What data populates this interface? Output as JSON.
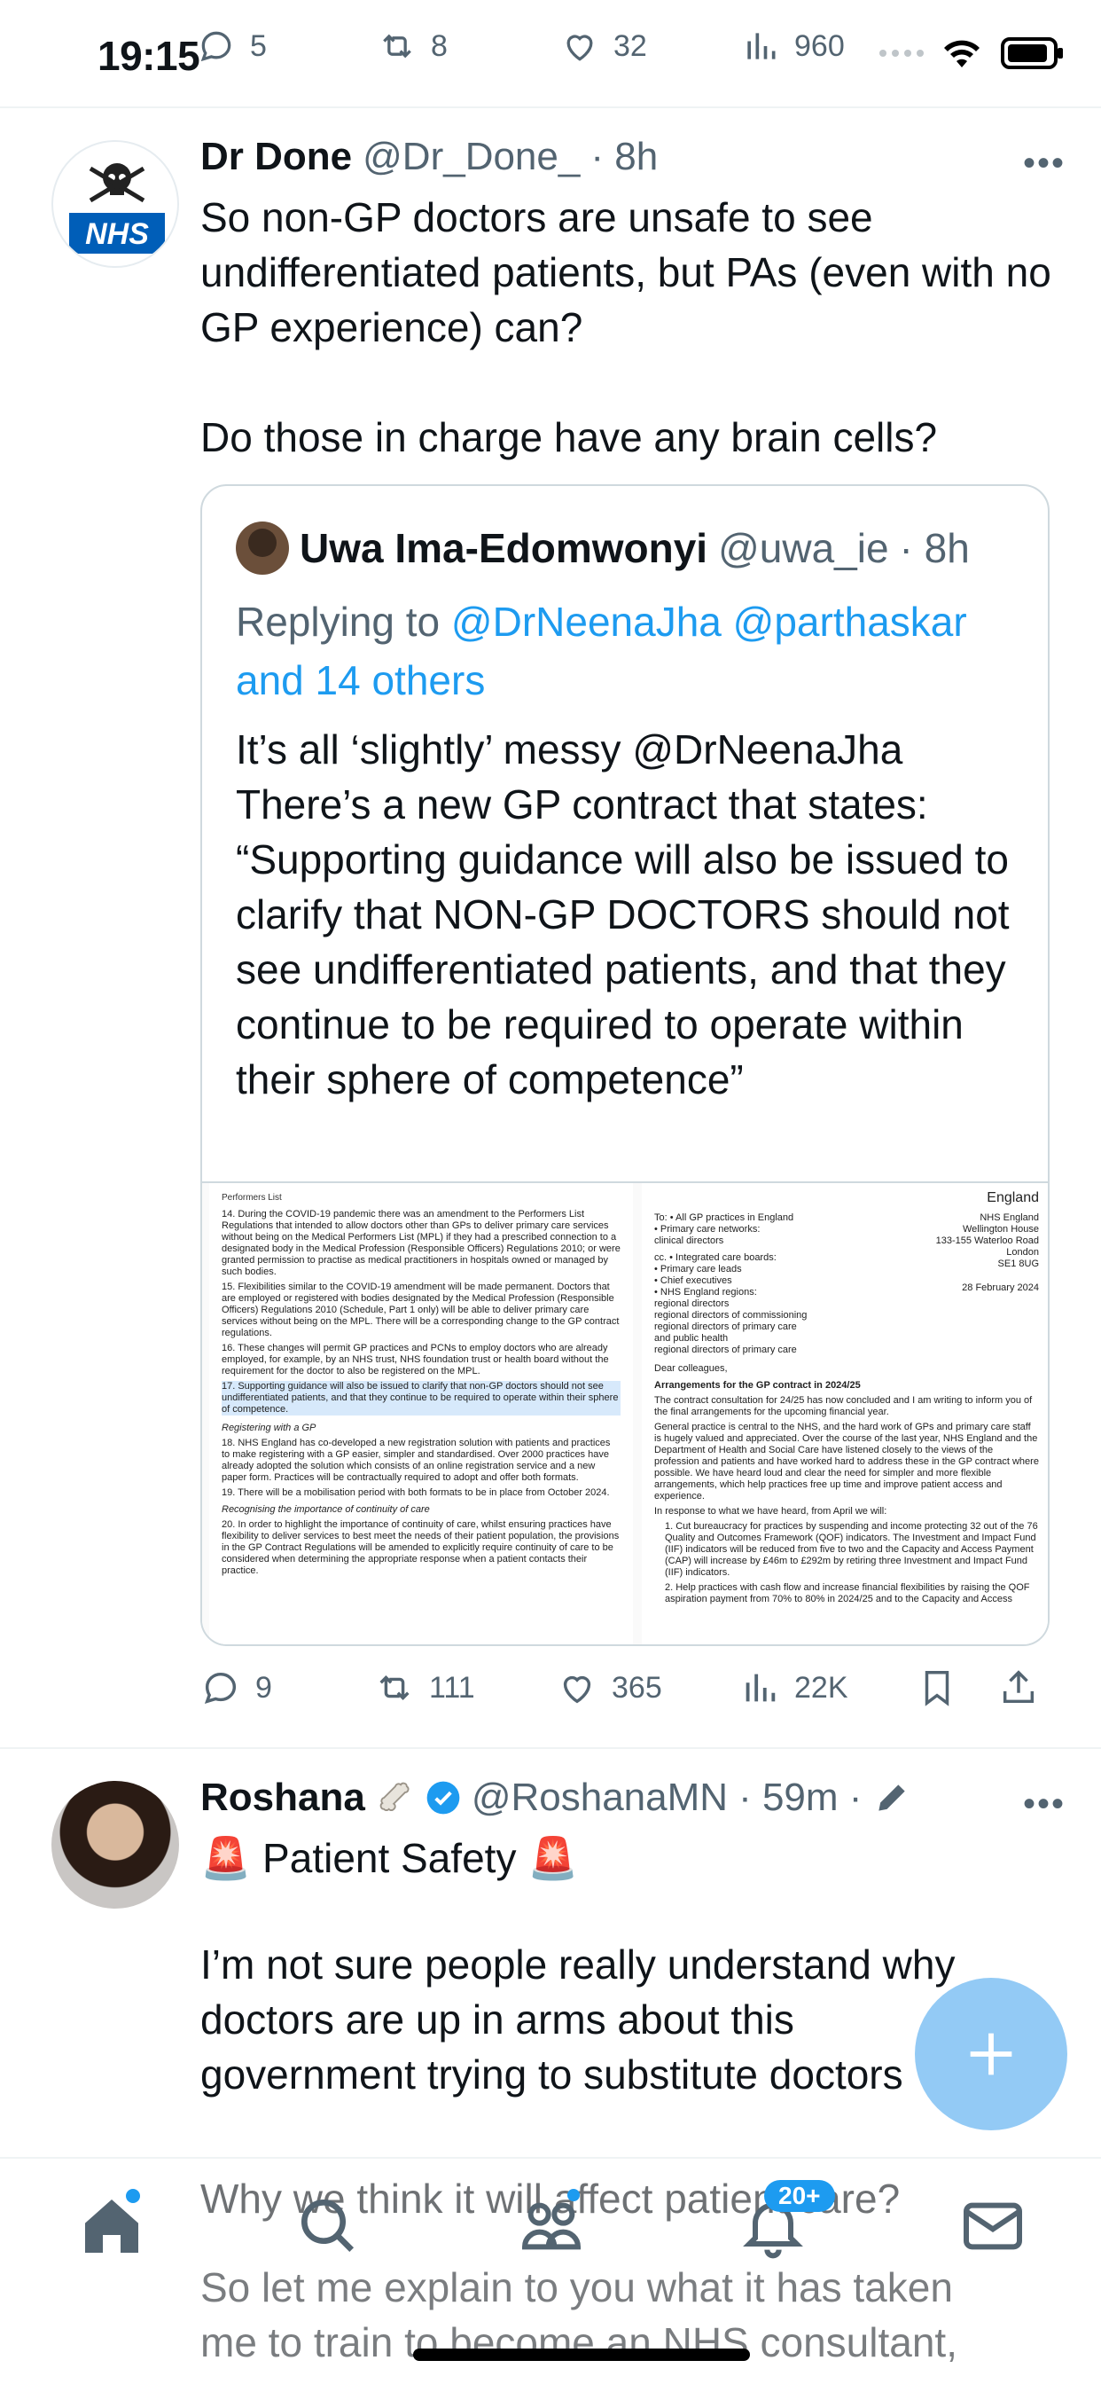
{
  "status": {
    "time": "19:15"
  },
  "prev_tweet_actions": {
    "replies": "5",
    "reposts": "8",
    "likes": "32",
    "views": "960"
  },
  "tweet1": {
    "name": "Dr Done",
    "handle": "@Dr_Done_",
    "time": "· 8h",
    "text_p1": "So non-GP doctors are unsafe to see undifferentiated patients, but PAs (even with no GP experience) can?",
    "text_p2": "Do those in charge have any brain cells?",
    "quote": {
      "name": "Uwa Ima-Edomwonyi",
      "handle": "@uwa_ie",
      "time": "· 8h",
      "replying_prefix": "Replying to",
      "reply_mentions": "@DrNeenaJha @parthaskar and 14 others",
      "text": "It’s all ‘slightly’ messy @DrNeenaJha There’s a new GP contract that states: “Supporting guidance will also be issued to clarify that NON-GP DOCTORS should not see undifferentiated patients, and that they continue to be required to operate within their sphere of competence”",
      "image": {
        "left_header": "Performers List",
        "right_header": "England",
        "p14": "14. During the COVID-19 pandemic there was an amendment to the Performers List Regulations that intended to allow doctors other than GPs to deliver primary care services without being on the Medical Performers List (MPL) if they had a prescribed connection to a designated body in the Medical Profession (Responsible Officers) Regulations 2010; or were granted permission to practise as medical practitioners in hospitals owned or managed by such bodies.",
        "p15": "15. Flexibilities similar to the COVID-19 amendment will be made permanent. Doctors that are employed or registered with bodies designated by the Medical Profession (Responsible Officers) Regulations 2010 (Schedule, Part 1 only) will be able to deliver primary care services without being on the MPL. There will be a corresponding change to the GP contract regulations.",
        "p16": "16. These changes will permit GP practices and PCNs to employ doctors who are already employed, for example, by an NHS trust, NHS foundation trust or health board without the requirement for the doctor to also be registered on the MPL.",
        "p17": "17. Supporting guidance will also be issued to clarify that non-GP doctors should not see undifferentiated patients, and that they continue to be required to operate within their sphere of competence.",
        "sub1": "Registering with a GP",
        "p18": "18. NHS England has co-developed a new registration solution with patients and practices to make registering with a GP easier, simpler and standardised. Over 2000 practices have already adopted the solution which consists of an online registration service and a new paper form. Practices will be contractually required to adopt and offer both formats.",
        "p19": "19. There will be a mobilisation period with both formats to be in place from October 2024.",
        "sub2": "Recognising the importance of continuity of care",
        "p20": "20. In order to highlight the importance of continuity of care, whilst ensuring practices have flexibility to deliver services to best meet the needs of their patient population, the provisions in the GP Contract Regulations will be amended to explicitly require continuity of care to be considered when determining the appropriate response when a patient contacts their practice.",
        "to_label": "To:",
        "to_1": "• All GP practices in England",
        "to_2": "• Primary care networks:",
        "to_2b": "clinical directors",
        "cc_label": "cc.",
        "cc_1": "• Integrated care boards:",
        "cc_2": "• Primary care leads",
        "cc_3": "• Chief executives",
        "cc_4": "• NHS England regions:",
        "cc_4b": "regional directors",
        "cc_4c": "regional directors of commissioning",
        "cc_4d": "regional directors of primary care",
        "cc_4e": "and public health",
        "cc_4f": "regional directors of primary care",
        "addr_1": "NHS England",
        "addr_2": "Wellington House",
        "addr_3": "133-155 Waterloo Road",
        "addr_4": "London",
        "addr_5": "SE1 8UG",
        "date": "28 February 2024",
        "greeting": "Dear colleagues,",
        "heading": "Arrangements for the GP contract in 2024/25",
        "r_p1": "The contract consultation for 24/25 has now concluded and I am writing to inform you of the final arrangements for the upcoming financial year.",
        "r_p2": "General practice is central to the NHS, and the hard work of GPs and primary care staff is hugely valued and appreciated. Over the course of the last year, NHS England and the Department of Health and Social Care have listened closely to the views of the profession and patients and have worked hard to address these in the GP contract where possible. We have heard loud and clear the need for simpler and more flexible arrangements, which help practices free up time and improve patient access and experience.",
        "r_p3": "In response to what we have heard, from April we will:",
        "r_l1": "1. Cut bureaucracy for practices by suspending and income protecting 32 out of the 76 Quality and Outcomes Framework (QOF) indicators. The Investment and Impact Fund (IIF) indicators will be reduced from five to two and the Capacity and Access Payment (CAP) will increase by £46m to £292m by retiring three Investment and Impact Fund (IIF) indicators.",
        "r_l2": "2. Help practices with cash flow and increase financial flexibilities by raising the QOF aspiration payment from 70% to 80% in 2024/25 and to the Capacity and Access"
      }
    },
    "actions": {
      "replies": "9",
      "reposts": "111",
      "likes": "365",
      "views": "22K"
    }
  },
  "tweet2": {
    "name": "Roshana",
    "handle": "@RoshanaMN",
    "time": "· 59m ·",
    "line1": "🚨 Patient Safety 🚨",
    "para1": "I’m not sure people really understand why doctors are up in arms about this government trying to substitute doctors",
    "para2": "Why we think it will affect patient care?",
    "para3": "So let me explain to you what it has taken me to train to become an NHS consultant,"
  },
  "nav": {
    "notifications_badge": "20+"
  },
  "colors": {
    "accent": "#1d9bf0",
    "muted": "#536471",
    "fab": "#8ec8f5"
  }
}
